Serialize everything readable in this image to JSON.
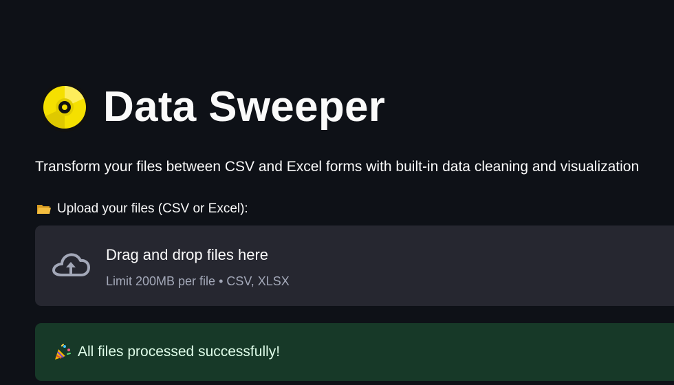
{
  "header": {
    "title": "Data Sweeper",
    "title_icon": "optical-disc-icon",
    "subtitle": "Transform your files between CSV and Excel forms with built-in data cleaning and visualization"
  },
  "uploader": {
    "label": "Upload your files (CSV or Excel):",
    "label_icon": "folder-icon",
    "drop_text": "Drag and drop files here",
    "limit_text": "Limit 200MB per file • CSV, XLSX",
    "icon": "cloud-upload-icon"
  },
  "status": {
    "icon": "party-popper-icon",
    "message": "All files processed successfully!"
  },
  "colors": {
    "background": "#0e1117",
    "dropzone": "#262730",
    "success_bg": "#173928",
    "success_text": "#dffde9",
    "muted_text": "#a3a8b8"
  }
}
